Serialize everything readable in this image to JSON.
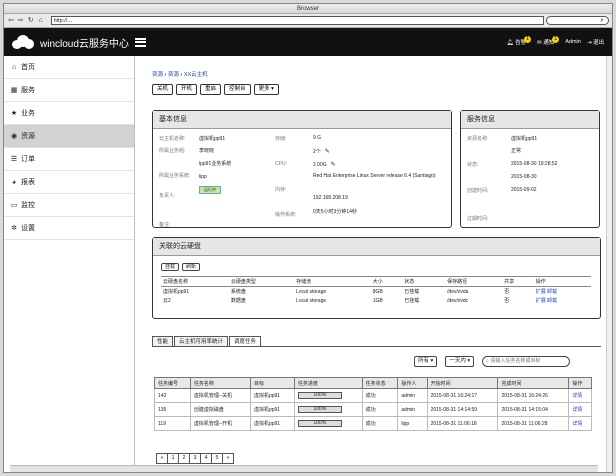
{
  "browser": {
    "title": "Browser",
    "url": "http://...",
    "nav_icons": [
      "back-icon",
      "forward-icon",
      "refresh-icon",
      "home-icon"
    ]
  },
  "app": {
    "brand": "wincloud云服务中心",
    "alerts_label": "告警",
    "alerts_count": "1",
    "notices_label": "通知",
    "notices_count": "1",
    "user": "Admin",
    "logout": "退出"
  },
  "sidebar": {
    "items": [
      {
        "icon": "home-icon",
        "glyph": "⌂",
        "label": "首页"
      },
      {
        "icon": "grid-icon",
        "glyph": "▦",
        "label": "服务"
      },
      {
        "icon": "star-icon",
        "glyph": "★",
        "label": "业务"
      },
      {
        "icon": "cube-icon",
        "glyph": "◉",
        "label": "资源",
        "active": true
      },
      {
        "icon": "list-icon",
        "glyph": "☰",
        "label": "订单"
      },
      {
        "icon": "pie-icon",
        "glyph": "◕",
        "label": "报表"
      },
      {
        "icon": "monitor-icon",
        "glyph": "▭",
        "label": "监控"
      },
      {
        "icon": "gear-icon",
        "glyph": "✲",
        "label": "设置"
      }
    ]
  },
  "breadcrumb": {
    "a": "资源",
    "b": "资源",
    "c": "XX云主机"
  },
  "toolbar": {
    "shutdown": "关机",
    "start": "开机",
    "restart": "重启",
    "console": "控制台",
    "more": "更多"
  },
  "basic": {
    "title": "基本信息",
    "name_k": "云主机名称:",
    "name_v": "虚拟机pp91",
    "owner_k": "所属业务组:",
    "owner_v": "李晓晓",
    "biz_v": "lpp91业务系统",
    "system_k": "所属业务系统:",
    "system_v": "lipp",
    "person_k": "负责人:",
    "status_v": "运行中",
    "storage_k": "存储:",
    "storage_v": "9 G",
    "cpu_count_k": "",
    "cpu_count_v": "2个",
    "cpu_k": "CPU:",
    "cpu_v": "2.00G",
    "os_v": "Red Hat Enterprise Linux Server release 6.4 (Santiago)",
    "mem_k": "内存:",
    "ip_v": "192.168.208.19",
    "uptime_k": "操作系统:",
    "uptime_v": "0天5小时3分钟14秒",
    "last_k": "备注:"
  },
  "service": {
    "title": "服务信息",
    "res_k": "资源名称:",
    "res_v": "虚拟机pp91",
    "normal_v": "正常",
    "state_k": "状态:",
    "state_v": "2015-08-30 19:28:52",
    "date2_v": "2015-08-30",
    "create_k": "创建时间:",
    "create_v": "2015-09-02",
    "expire_k": "过期时间:"
  },
  "disks": {
    "title": "关联的云硬盘",
    "btn_mount": "挂载",
    "btn_refresh": "刷新",
    "headers": [
      "云硬盘名称",
      "云硬盘类型",
      "存储池",
      "大小",
      "状态",
      "保存路径",
      "共享",
      "操作"
    ],
    "rows": [
      [
        "虚拟机pp91",
        "系统盘",
        "Local storage",
        "8GB",
        "已挂载",
        "/dev/xvda",
        "否",
        "扩展 卸载"
      ],
      [
        "云2",
        "数据盘",
        "Local storage",
        "1GB",
        "已挂载",
        "/dev/xvdc",
        "否",
        "扩展 卸载"
      ]
    ]
  },
  "tabs": [
    "性能",
    "云主机可用率统计",
    "调度任务"
  ],
  "filters": {
    "all": "所有",
    "period": "一天内",
    "search_placeholder": "请输入任务名称或目标"
  },
  "tasks": {
    "headers": [
      "任务编号",
      "任务名称",
      "目标",
      "任务进度",
      "任务状态",
      "操作人",
      "开始时间",
      "完成时间",
      "操作"
    ],
    "rows": [
      {
        "id": "143",
        "name": "虚拟机管理--关机",
        "target": "虚拟机pp91",
        "progress": 100,
        "progress_label": "100%",
        "status": "成功",
        "user": "admin",
        "start": "2015-08-31 16:24:17",
        "end": "2015-08-31 16:24:26",
        "op": "详情"
      },
      {
        "id": "135",
        "name": "创建虚拟磁盘",
        "target": "虚拟机pp91",
        "progress": 100,
        "progress_label": "100%",
        "status": "成功",
        "user": "admin",
        "start": "2015-08-31 14:14:59",
        "end": "2015-08-31 14:15:04",
        "op": "详情"
      },
      {
        "id": "119",
        "name": "虚拟机管理--开机",
        "target": "虚拟机pp91",
        "progress": 100,
        "progress_label": "100%",
        "status": "成功",
        "user": "lipp",
        "start": "2015-08-31 11:06:18",
        "end": "2015-08-31 11:06:28",
        "op": "详情"
      }
    ]
  },
  "pager": [
    "«",
    "1",
    "2",
    "3",
    "4",
    "5",
    "»"
  ]
}
